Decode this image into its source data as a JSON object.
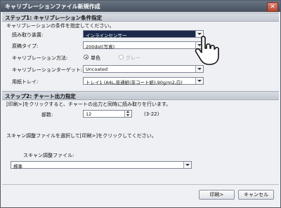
{
  "window": {
    "title": "キャリブレーションファイル新規作成",
    "close_glyph": "✕"
  },
  "step1": {
    "header": "ステップ1: キャリブレーション条件指定",
    "instruction": "キャリブレーションの条件を指定してください。",
    "reader": {
      "label": "読み取り装置:",
      "value": "インラインセンサー"
    },
    "original": {
      "label": "原稿タイプ:",
      "value": "200dot(写真)"
    },
    "method": {
      "label": "キャリブレーション方法:",
      "options": [
        "単色",
        "グレー"
      ],
      "selected": "単色"
    },
    "target": {
      "label": "キャリブレーションターゲット:",
      "value": "Uncoated"
    },
    "tray": {
      "label": "用紙トレイ:",
      "value": "トレイ1 (A4L,普通紙(非コート紙),90g/m2,白)"
    }
  },
  "step2": {
    "header": "ステップ2: チャート出力指定",
    "instruction": "[印刷>]をクリックすると、チャートの出力と同時に読み取りを行います。",
    "copies": {
      "label": "部数:",
      "value": "12",
      "range": "(3-22)"
    },
    "scan_instruction": "スキャン調整ファイルを選択して[印刷>]をクリックしてください。",
    "scan_file": {
      "label": "スキャン調整ファイル:",
      "value": "標準"
    }
  },
  "buttons": {
    "print": "印刷>",
    "cancel": "キャンセル"
  },
  "colors": {
    "highlight": "#1c2a4c",
    "titlebar": "#4f5a68"
  }
}
